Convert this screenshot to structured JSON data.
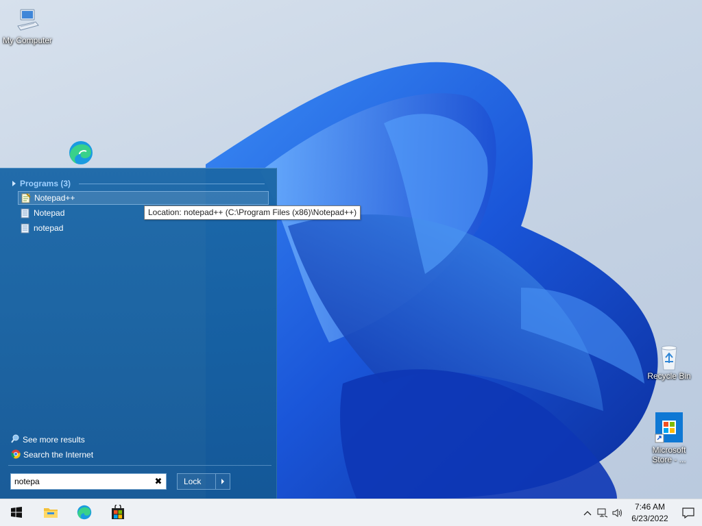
{
  "desktop": {
    "icons": [
      {
        "label": "My Computer",
        "icon": "computer-icon"
      },
      {
        "label": "",
        "icon": "edge-icon"
      },
      {
        "label": "Recycle Bin",
        "icon": "recycle-bin-icon"
      },
      {
        "label": "Microsoft Store - ...",
        "icon": "store-icon"
      }
    ]
  },
  "start_menu": {
    "group_header": "Programs (3)",
    "items": [
      {
        "label": "Notepad++",
        "icon": "notepadpp-icon",
        "highlighted": true
      },
      {
        "label": "Notepad",
        "icon": "notepad-icon",
        "highlighted": false
      },
      {
        "label": "notepad",
        "icon": "notepad-icon",
        "highlighted": false
      }
    ],
    "tooltip": "Location: notepad++ (C:\\Program Files (x86)\\Notepad++)",
    "see_more": "See more results",
    "search_internet": "Search the Internet",
    "search": {
      "value": "notepa",
      "clear_icon": "close-icon"
    },
    "lock_label": "Lock"
  },
  "taskbar": {
    "buttons": [
      {
        "name": "start-button",
        "icon": "windows-icon"
      },
      {
        "name": "file-explorer-button",
        "icon": "folder-icon"
      },
      {
        "name": "edge-button",
        "icon": "edge-icon"
      },
      {
        "name": "store-button",
        "icon": "store-icon"
      }
    ],
    "tray_icons": [
      "chevron-up-icon",
      "network-icon",
      "volume-icon"
    ],
    "clock": {
      "time": "7:46 AM",
      "date": "6/23/2022"
    },
    "notification_icon": "notification-icon"
  },
  "colors": {
    "start_menu_bg": "#1c68a8",
    "group_header": "#9fd0ff",
    "taskbar_bg": "#eef1f5",
    "wallpaper_bloom": "#1f5fe0"
  }
}
